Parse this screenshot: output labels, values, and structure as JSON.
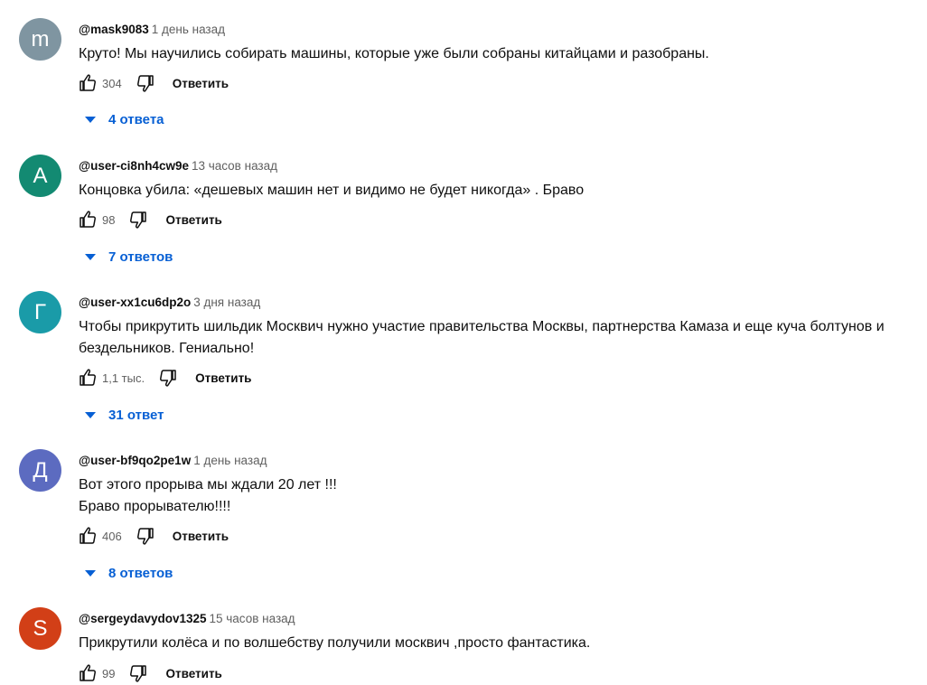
{
  "comments": [
    {
      "author": "@mask9083",
      "time": "1 день назад",
      "avatar_letter": "m",
      "avatar_color": "#7f95a1",
      "text_lines": [
        "Круто! Мы научились собирать машины, которые уже были собраны китайцами и разобраны."
      ],
      "likes": "304",
      "reply_label": "Ответить",
      "replies_label": "4 ответа"
    },
    {
      "author": "@user-ci8nh4cw9e",
      "time": "13 часов назад",
      "avatar_letter": "A",
      "avatar_color": "#138a72",
      "text_lines": [
        "Концовка убила: «дешевых машин нет и видимо не будет никогда» . Браво"
      ],
      "likes": "98",
      "reply_label": "Ответить",
      "replies_label": "7 ответов"
    },
    {
      "author": "@user-xx1cu6dp2o",
      "time": "3 дня назад",
      "avatar_letter": "Г",
      "avatar_color": "#1a9ba8",
      "text_lines": [
        "Чтобы прикрутить шильдик Москвич нужно участие правительства Москвы, партнерства Камаза и еще куча болтунов и",
        "бездельников. Гениально!"
      ],
      "likes": "1,1 тыс.",
      "reply_label": "Ответить",
      "replies_label": "31 ответ"
    },
    {
      "author": "@user-bf9qo2pe1w",
      "time": "1 день назад",
      "avatar_letter": "Д",
      "avatar_color": "#5c6bc0",
      "text_lines": [
        "Вот этого прорыва мы ждали 20 лет !!!",
        "Браво прорывателю!!!!"
      ],
      "likes": "406",
      "reply_label": "Ответить",
      "replies_label": "8 ответов"
    },
    {
      "author": "@sergeydavydov1325",
      "time": "15 часов назад",
      "avatar_letter": "S",
      "avatar_color": "#d23f17",
      "text_lines": [
        "Прикрутили колёса и по волшебству получили москвич ,просто фантастика."
      ],
      "likes": "99",
      "reply_label": "Ответить",
      "replies_label": null
    }
  ],
  "icons": {
    "like": "thumb-up-icon",
    "dislike": "thumb-down-icon",
    "expand": "caret-down-icon"
  },
  "colors": {
    "link_blue": "#065fd4",
    "meta_gray": "#606060",
    "text": "#0f0f0f"
  }
}
